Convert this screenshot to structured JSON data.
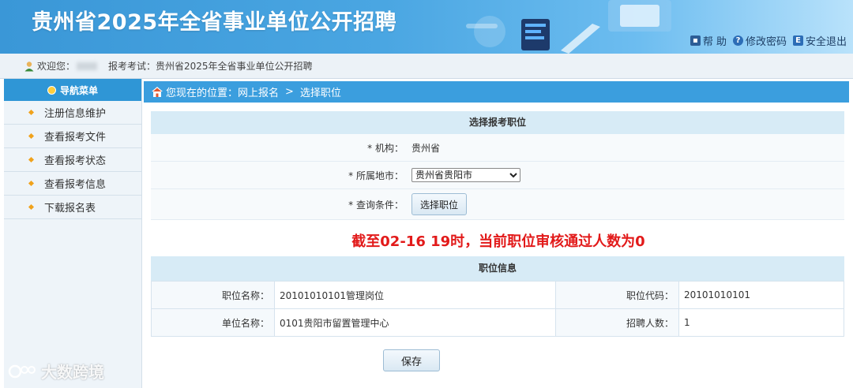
{
  "header": {
    "title": "贵州省2025年全省事业单位公开招聘",
    "links": [
      {
        "icon": "lock-icon",
        "label": "帮 助"
      },
      {
        "icon": "help-circle-icon",
        "label": "修改密码"
      },
      {
        "icon": "exit-icon",
        "label": "安全退出"
      }
    ]
  },
  "welcome": {
    "greeting": "欢迎您：",
    "exam_label": "报考考试：贵州省2025年全省事业单位公开招聘"
  },
  "sidebar": {
    "title": "导航菜单",
    "items": [
      {
        "label": "注册信息维护"
      },
      {
        "label": "查看报考文件"
      },
      {
        "label": "查看报考状态"
      },
      {
        "label": "查看报考信息"
      },
      {
        "label": "下载报名表"
      }
    ]
  },
  "breadcrumb": {
    "prefix": "您现在的位置：网上报名",
    "separator": ">",
    "current": "选择职位"
  },
  "select_panel": {
    "title": "选择报考职位",
    "org_label": "* 机构：",
    "org_value": "贵州省",
    "city_label": "* 所属地市：",
    "city_selected": "贵州省贵阳市",
    "query_label": "* 查询条件：",
    "choose_button": "选择职位"
  },
  "notice": "截至02-16 19时，当前职位审核通过人数为0",
  "position_info": {
    "title": "职位信息",
    "name_label": "职位名称：",
    "name_value": "20101010101管理岗位",
    "code_label": "职位代码：",
    "code_value": "20101010101",
    "unit_label": "单位名称：",
    "unit_value": "0101贵阳市留置管理中心",
    "count_label": "招聘人数：",
    "count_value": "1"
  },
  "save_button": "保存",
  "watermark": "大数跨境",
  "colors": {
    "header_blue": "#3a97d7",
    "nav_blue": "#2f96d6",
    "notice_red": "#e21a1a",
    "panel_head": "#d7ebf6"
  }
}
